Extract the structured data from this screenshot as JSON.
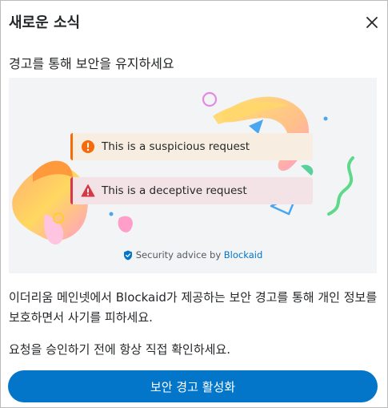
{
  "dialog": {
    "title": "새로운 소식",
    "subtitle": "경고를 통해 보안을 유지하세요",
    "close_icon": "close-icon"
  },
  "hero": {
    "alerts": [
      {
        "text": "This is a suspicious request",
        "icon": "warning-circle-icon",
        "color": "#f66a0a"
      },
      {
        "text": "This is a deceptive request",
        "icon": "danger-triangle-icon",
        "color": "#d73847"
      }
    ],
    "credit_prefix": "Security advice by ",
    "credit_brand": "Blockaid"
  },
  "body": {
    "paragraph1": "이더리움 메인넷에서 Blockaid가 제공하는 보안 경고를 통해 개인 정보를 보호하면서 사기를 피하세요.",
    "paragraph2": "요청을 승인하기 전에 항상 직접 확인하세요."
  },
  "actions": {
    "enable_label": "보안 경고 활성화"
  },
  "colors": {
    "accent": "#0376c9",
    "text": "#24272a"
  }
}
